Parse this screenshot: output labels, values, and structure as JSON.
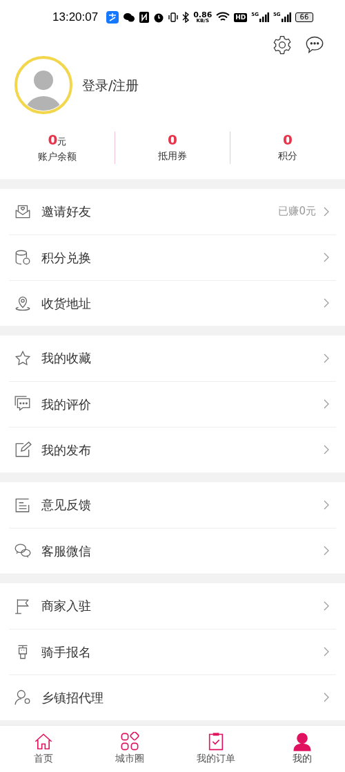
{
  "status_bar": {
    "time": "13:20:07",
    "net_speed": "0.86",
    "net_unit": "KB/S",
    "hd": "HD",
    "signal_labels": [
      "5G",
      "5G"
    ],
    "battery": "66"
  },
  "profile": {
    "login": "登录/注册"
  },
  "stats": [
    {
      "value": "0",
      "unit": "元",
      "label": "账户余额"
    },
    {
      "value": "0",
      "label": "抵用券"
    },
    {
      "value": "0",
      "label": "积分"
    }
  ],
  "menu_groups": [
    [
      {
        "kind": "invite",
        "label": "邀请好友",
        "extra": "已赚0元"
      },
      {
        "kind": "points",
        "label": "积分兑换"
      },
      {
        "kind": "address",
        "label": "收货地址"
      }
    ],
    [
      {
        "kind": "favorites",
        "label": "我的收藏"
      },
      {
        "kind": "reviews",
        "label": "我的评价"
      },
      {
        "kind": "posts",
        "label": "我的发布"
      }
    ],
    [
      {
        "kind": "feedback",
        "label": "意见反馈"
      },
      {
        "kind": "service",
        "label": "客服微信"
      }
    ],
    [
      {
        "kind": "merchant",
        "label": "商家入驻"
      },
      {
        "kind": "rider",
        "label": "骑手报名"
      },
      {
        "kind": "agent",
        "label": "乡镇招代理"
      }
    ]
  ],
  "tabs": [
    {
      "kind": "home",
      "label": "首页",
      "selected": false
    },
    {
      "kind": "grid",
      "label": "城市圈",
      "selected": false
    },
    {
      "kind": "order",
      "label": "我的订单",
      "selected": false
    },
    {
      "kind": "me",
      "label": "我的",
      "selected": true
    }
  ]
}
